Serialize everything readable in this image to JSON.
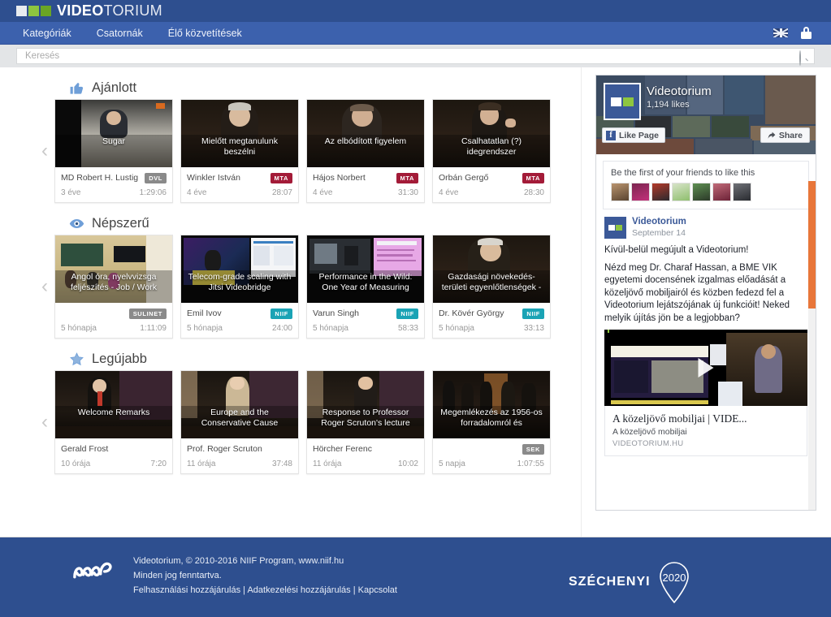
{
  "brand": {
    "name_bold": "VIDEO",
    "name_thin": "TORIUM"
  },
  "nav": {
    "items": [
      {
        "label": "Kategóriák",
        "name": "nav-kategoriak"
      },
      {
        "label": "Csatornák",
        "name": "nav-csatornak"
      },
      {
        "label": "Élő közvetítések",
        "name": "nav-elo-kozvetitesek"
      }
    ],
    "language_icon": "uk-flag-icon",
    "login_icon": "lock-icon"
  },
  "search": {
    "placeholder": "Keresés",
    "value": "",
    "icon": "search-icon"
  },
  "sections": [
    {
      "title": "Ajánlott",
      "icon": "thumbs-up-icon",
      "prev_label": "‹",
      "next_label": "›",
      "cards": [
        {
          "title": "Sugar",
          "author": "MD Robert H. Lustig",
          "badge": "DVL",
          "age": "3 éve",
          "duration": "1:29:06"
        },
        {
          "title": "Mielőtt megtanulunk beszélni",
          "author": "Winkler István",
          "badge": "MTA",
          "age": "4 éve",
          "duration": "28:07"
        },
        {
          "title": "Az elbódított figyelem",
          "author": "Hájos Norbert",
          "badge": "MTA",
          "age": "4 éve",
          "duration": "31:30"
        },
        {
          "title": "Csalhatatlan (?) idegrendszer",
          "author": "Orbán Gergő",
          "badge": "MTA",
          "age": "4 éve",
          "duration": "28:30"
        }
      ]
    },
    {
      "title": "Népszerű",
      "icon": "eye-icon",
      "prev_label": "‹",
      "next_label": "›",
      "cards": [
        {
          "title": "Angol óra, nyelvvizsga feljészítés - Job / Work",
          "author": "",
          "badge": "SULINET",
          "age": "5 hónapja",
          "duration": "1:11:09"
        },
        {
          "title": "Telecom-grade scaling with Jitsi Videobridge",
          "author": "Emil Ivov",
          "badge": "NIIF",
          "age": "5 hónapja",
          "duration": "24:00"
        },
        {
          "title": "Performance in the Wild: One Year of Measuring",
          "author": "Varun Singh",
          "badge": "NIIF",
          "age": "5 hónapja",
          "duration": "58:33"
        },
        {
          "title": "Gazdasági növekedés- területi egyenlőtlenségek -",
          "author": "Dr. Kövér György",
          "badge": "NIIF",
          "age": "5 hónapja",
          "duration": "33:13"
        }
      ]
    },
    {
      "title": "Legújabb",
      "icon": "star-icon",
      "prev_label": "‹",
      "next_label": "›",
      "cards": [
        {
          "title": "Welcome Remarks",
          "author": "Gerald Frost",
          "badge": "",
          "age": "10 órája",
          "duration": "7:20"
        },
        {
          "title": "Europe and the Conservative Cause",
          "author": "Prof. Roger Scruton",
          "badge": "",
          "age": "11 órája",
          "duration": "37:48"
        },
        {
          "title": "Response to Professor Roger Scruton's lecture",
          "author": "Hörcher Ferenc",
          "badge": "",
          "age": "11 órája",
          "duration": "10:02"
        },
        {
          "title": "Megemlékezés az 1956-os forradalomról és",
          "author": "",
          "badge": "SEK",
          "age": "5 napja",
          "duration": "1:07:55"
        }
      ]
    }
  ],
  "facebook": {
    "page_name": "Videotorium",
    "likes": "1,194 likes",
    "like_button": "Like Page",
    "share_button": "Share",
    "friends_prompt": "Be the first of your friends to like this",
    "post": {
      "author": "Videotorium",
      "date": "September 14",
      "paragraphs": [
        "Kívül-belül megújult a Videotorium!",
        "Nézd meg Dr. Charaf Hassan, a BME VIK egyetemi docensének izgalmas előadását a közeljövő mobiljairól és közben fedezd fel a Videotorium lejátszójának új funkcióit! Neked melyik újítás jön be a legjobban?"
      ],
      "link_title": "A közeljövő mobiljai | VIDE...",
      "link_subtitle": "A közeljövő mobiljai",
      "link_domain": "VIDEOTORIUM.HU",
      "play_icon": "play-icon"
    }
  },
  "footer": {
    "line1": "Videotorium, © 2010-2016 NIIF Program, www.niif.hu",
    "line2": "Minden jog fenntartva.",
    "links": [
      {
        "label": "Felhasználási hozzájárulás"
      },
      {
        "label": "Adatkezelési hozzájárulás"
      },
      {
        "label": "Kapcsolat"
      }
    ],
    "separator": " | ",
    "szechenyi_word": "SZÉCHENYI",
    "szechenyi_year": "2020",
    "niif_logo": "niif-logo"
  },
  "colors": {
    "brand_dark": "#2e4f8f",
    "nav_blue": "#3c61ad",
    "badge_mta": "#a31b38",
    "badge_niif": "#1aa3b5",
    "badge_grey": "#8a8a8a",
    "fb_blue": "#3b5998",
    "scrollbar_orange": "#e8763a"
  }
}
